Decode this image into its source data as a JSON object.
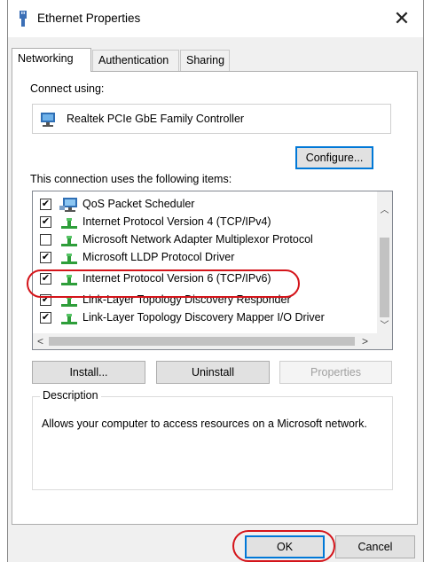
{
  "window": {
    "title": "Ethernet Properties",
    "close_glyph": "✕"
  },
  "tabs": [
    {
      "label": "Networking",
      "active": true
    },
    {
      "label": "Authentication",
      "active": false
    },
    {
      "label": "Sharing",
      "active": false
    }
  ],
  "connect_using": {
    "label": "Connect using:",
    "adapter": "Realtek PCIe GbE Family Controller",
    "adapter_icon": "network-adapter-icon"
  },
  "configure_label": "Configure...",
  "items_label": "This connection uses the following items:",
  "items": [
    {
      "label": "QoS Packet Scheduler",
      "checked": true,
      "icon": "monitor-network-icon"
    },
    {
      "label": "Internet Protocol Version 4 (TCP/IPv4)",
      "checked": true,
      "icon": "protocol-icon"
    },
    {
      "label": "Microsoft Network Adapter Multiplexor Protocol",
      "checked": false,
      "icon": "protocol-icon"
    },
    {
      "label": "Microsoft LLDP Protocol Driver",
      "checked": true,
      "icon": "protocol-icon"
    },
    {
      "label": "Internet Protocol Version 6 (TCP/IPv6)",
      "checked": true,
      "icon": "protocol-icon"
    },
    {
      "label": "Link-Layer Topology Discovery Responder",
      "checked": true,
      "icon": "protocol-icon"
    },
    {
      "label": "Link-Layer Topology Discovery Mapper I/O Driver",
      "checked": true,
      "icon": "protocol-icon"
    }
  ],
  "buttons": {
    "install": "Install...",
    "uninstall": "Uninstall",
    "properties": "Properties",
    "ok": "OK",
    "cancel": "Cancel"
  },
  "description": {
    "legend": "Description",
    "text": "Allows your computer to access resources on a Microsoft network."
  },
  "colors": {
    "highlight": "#d4141a",
    "focus_border": "#0078d7",
    "protocol_green": "#2e9e3a"
  }
}
